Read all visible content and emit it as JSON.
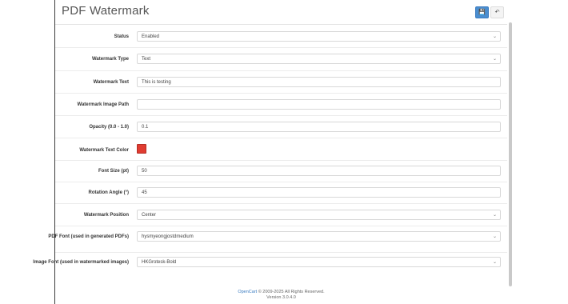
{
  "header": {
    "title": "PDF Watermark",
    "save_icon": "save-icon",
    "back_icon": "back-icon"
  },
  "form": {
    "fields": [
      {
        "label": "Status",
        "value": "Enabled",
        "type": "select"
      },
      {
        "label": "Watermark Type",
        "value": "Text",
        "type": "select"
      },
      {
        "label": "Watermark Text",
        "value": "This is testing",
        "type": "input"
      },
      {
        "label": "Watermark Image Path",
        "value": "",
        "type": "input"
      },
      {
        "label": "Opacity (0.0 - 1.0)",
        "value": "0.1",
        "type": "input"
      },
      {
        "label": "Watermark Text Color",
        "value": "#e03c31",
        "type": "color"
      },
      {
        "label": "Font Size (pt)",
        "value": "50",
        "type": "input"
      },
      {
        "label": "Rotation Angle (°)",
        "value": "45",
        "type": "input"
      },
      {
        "label": "Watermark Position",
        "value": "Center",
        "type": "select"
      },
      {
        "label": "PDF Font (used in generated PDFs)",
        "value": "hysmyeongjostdmedium",
        "type": "select"
      },
      {
        "label": "Image Font (used in watermarked images)",
        "value": "HKGrotesk-Bold",
        "type": "select"
      }
    ]
  },
  "footer": {
    "link": "OpenCart",
    "copyright": " © 2009-2025 All Rights Reserved.",
    "version": "Version 3.0.4.0"
  },
  "colors": {
    "accent": "#4a8ed0",
    "swatch": "#e03c31"
  }
}
